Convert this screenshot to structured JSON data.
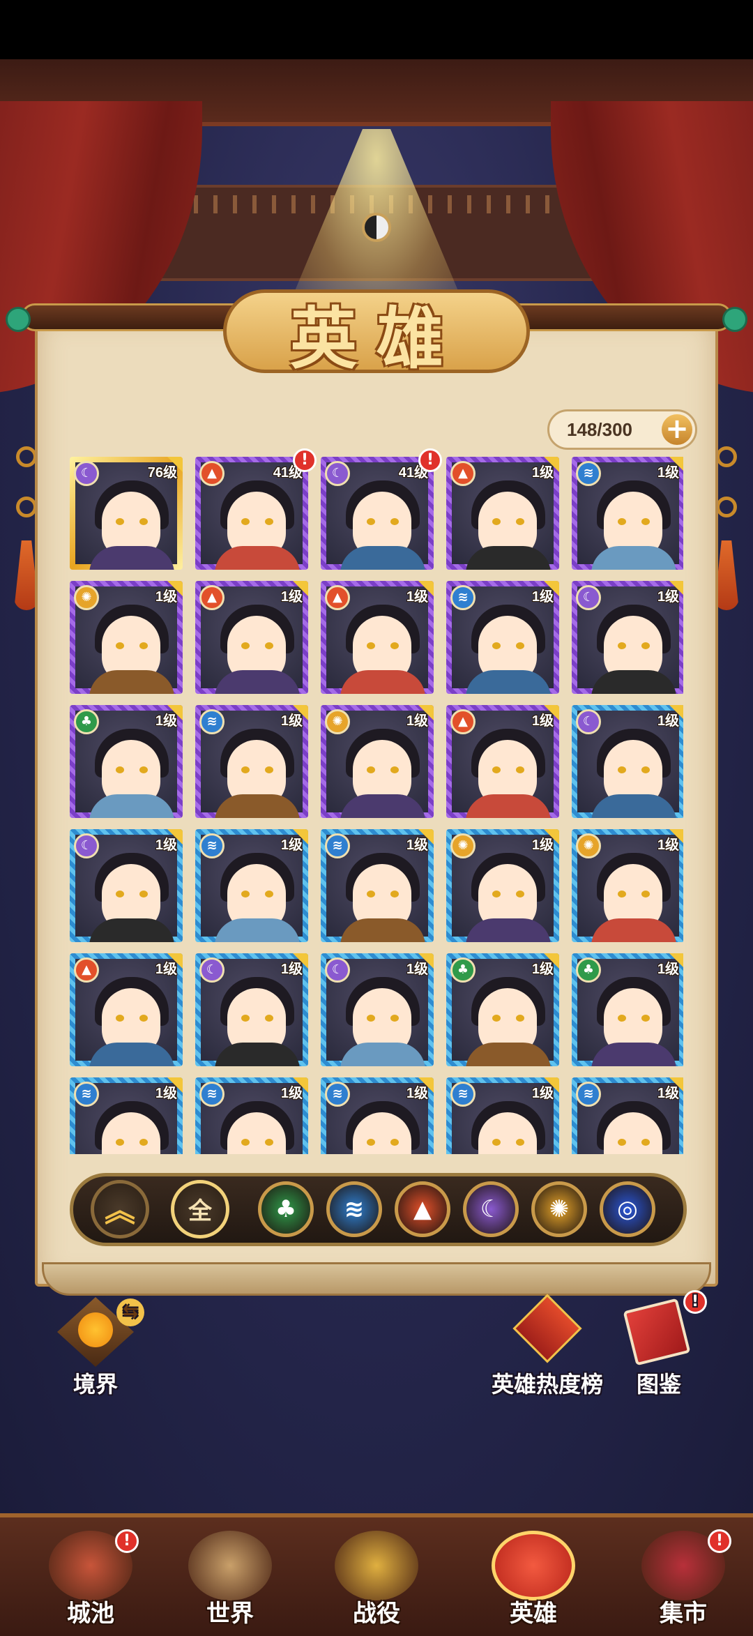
{
  "header": {
    "title": "英雄",
    "hero_count": "148/300",
    "add_label": "+"
  },
  "heroes": [
    {
      "level": "76级",
      "frame": "gold",
      "element": "moon",
      "alert": false
    },
    {
      "level": "41级",
      "frame": "purple",
      "element": "fire",
      "alert": true
    },
    {
      "level": "41级",
      "frame": "purple",
      "element": "moon",
      "alert": true
    },
    {
      "level": "1级",
      "frame": "purple",
      "element": "fire",
      "alert": false
    },
    {
      "level": "1级",
      "frame": "purple",
      "element": "water",
      "alert": false
    },
    {
      "level": "1级",
      "frame": "purple",
      "element": "sun",
      "alert": false
    },
    {
      "level": "1级",
      "frame": "purple",
      "element": "fire",
      "alert": false
    },
    {
      "level": "1级",
      "frame": "purple",
      "element": "fire",
      "alert": false
    },
    {
      "level": "1级",
      "frame": "purple",
      "element": "water",
      "alert": false
    },
    {
      "level": "1级",
      "frame": "purple",
      "element": "moon",
      "alert": false
    },
    {
      "level": "1级",
      "frame": "purple",
      "element": "wood",
      "alert": false
    },
    {
      "level": "1级",
      "frame": "purple",
      "element": "water",
      "alert": false
    },
    {
      "level": "1级",
      "frame": "purple",
      "element": "sun",
      "alert": false
    },
    {
      "level": "1级",
      "frame": "purple",
      "element": "fire",
      "alert": false
    },
    {
      "level": "1级",
      "frame": "blue",
      "element": "moon",
      "alert": false
    },
    {
      "level": "1级",
      "frame": "blue",
      "element": "moon",
      "alert": false
    },
    {
      "level": "1级",
      "frame": "blue",
      "element": "water",
      "alert": false
    },
    {
      "level": "1级",
      "frame": "blue",
      "element": "water",
      "alert": false
    },
    {
      "level": "1级",
      "frame": "blue",
      "element": "sun",
      "alert": false
    },
    {
      "level": "1级",
      "frame": "blue",
      "element": "sun",
      "alert": false
    },
    {
      "level": "1级",
      "frame": "blue",
      "element": "fire",
      "alert": false
    },
    {
      "level": "1级",
      "frame": "blue",
      "element": "moon",
      "alert": false
    },
    {
      "level": "1级",
      "frame": "blue",
      "element": "moon",
      "alert": false
    },
    {
      "level": "1级",
      "frame": "blue",
      "element": "wood",
      "alert": false
    },
    {
      "level": "1级",
      "frame": "blue",
      "element": "wood",
      "alert": false
    },
    {
      "level": "1级",
      "frame": "blue",
      "element": "water",
      "alert": false
    },
    {
      "level": "1级",
      "frame": "blue",
      "element": "water",
      "alert": false
    },
    {
      "level": "1级",
      "frame": "blue",
      "element": "water",
      "alert": false
    },
    {
      "level": "1级",
      "frame": "blue",
      "element": "water",
      "alert": false
    },
    {
      "level": "1级",
      "frame": "blue",
      "element": "water",
      "alert": false
    }
  ],
  "filters": {
    "sort_icon": "chevron-up-icon",
    "all_label": "全",
    "elements": [
      {
        "name": "wood",
        "icon": "leaf-icon",
        "color": "#2f9a4a"
      },
      {
        "name": "water",
        "icon": "wave-icon",
        "color": "#2f7fd0"
      },
      {
        "name": "fire",
        "icon": "flame-icon",
        "color": "#e2502a"
      },
      {
        "name": "moon",
        "icon": "moon-icon",
        "color": "#8a5ad0"
      },
      {
        "name": "sun",
        "icon": "sun-icon",
        "color": "#e6a42a"
      },
      {
        "name": "wind",
        "icon": "swirl-icon",
        "color": "#2a56d6"
      }
    ]
  },
  "side_buttons": {
    "realm": "境界",
    "hero_ranking": "英雄热度榜",
    "codex": "图鉴"
  },
  "nav": {
    "items": [
      {
        "label": "城池",
        "alert": true,
        "active": false
      },
      {
        "label": "世界",
        "alert": false,
        "active": false
      },
      {
        "label": "战役",
        "alert": false,
        "active": false
      },
      {
        "label": "英雄",
        "alert": false,
        "active": true
      },
      {
        "label": "集市",
        "alert": true,
        "active": false
      }
    ]
  },
  "colors": {
    "element_wood": "#2f9a4a",
    "element_water": "#2f7fd0",
    "element_fire": "#e2502a",
    "element_moon": "#8a5ad0",
    "element_sun": "#e6a42a",
    "alert": "#e0312a"
  }
}
